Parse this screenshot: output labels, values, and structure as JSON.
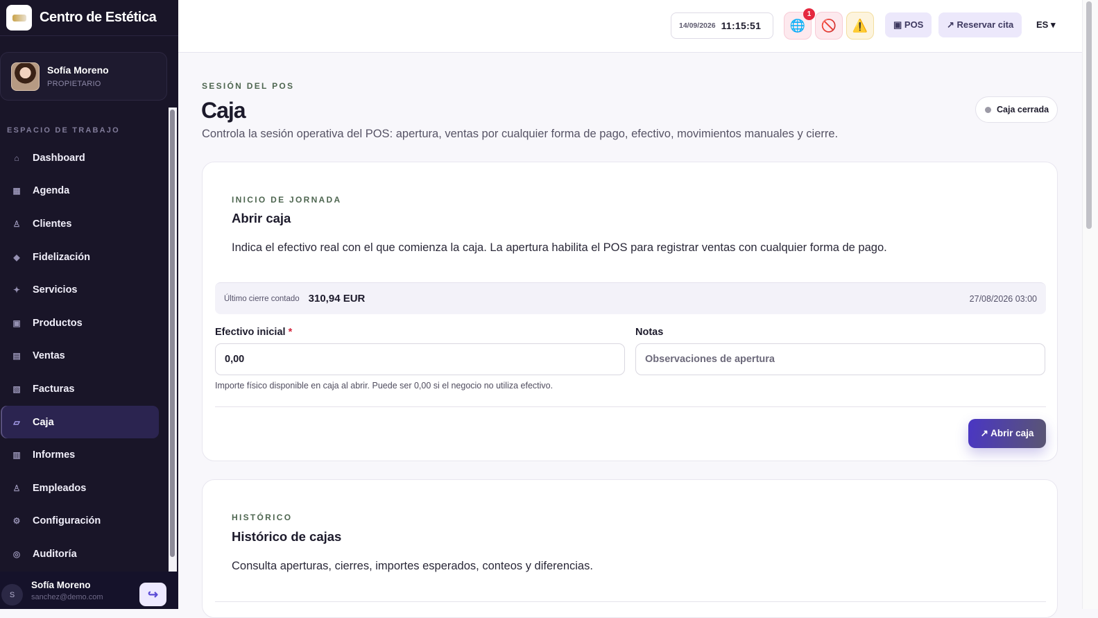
{
  "brand": {
    "name": "Centro de Estética"
  },
  "user": {
    "name": "Sofía Moreno",
    "role": "PROPIETARIO"
  },
  "sidebar": {
    "section_label": "ESPACIO DE TRABAJO",
    "items": [
      {
        "label": "Dashboard",
        "icon": "home-icon",
        "glyph": "⌂"
      },
      {
        "label": "Agenda",
        "icon": "calendar-icon",
        "glyph": "▦"
      },
      {
        "label": "Clientes",
        "icon": "clients-icon",
        "glyph": "♙"
      },
      {
        "label": "Fidelización",
        "icon": "diamond-icon",
        "glyph": "◆"
      },
      {
        "label": "Servicios",
        "icon": "sparkle-icon",
        "glyph": "✦"
      },
      {
        "label": "Productos",
        "icon": "box-icon",
        "glyph": "▣"
      },
      {
        "label": "Ventas",
        "icon": "receipt-icon",
        "glyph": "▤"
      },
      {
        "label": "Facturas",
        "icon": "invoice-icon",
        "glyph": "▧"
      },
      {
        "label": "Caja",
        "icon": "cash-register-icon",
        "glyph": "▱",
        "active": true
      },
      {
        "label": "Informes",
        "icon": "reports-icon",
        "glyph": "▥"
      },
      {
        "label": "Empleados",
        "icon": "employees-icon",
        "glyph": "♙"
      },
      {
        "label": "Configuración",
        "icon": "gear-icon",
        "glyph": "⚙"
      },
      {
        "label": "Auditoría",
        "icon": "audit-icon",
        "glyph": "◎"
      }
    ],
    "footer": {
      "avatar": "S",
      "name": "Sofía Moreno",
      "email": "sanchez@demo.com"
    }
  },
  "topbar": {
    "date": "14/09/2026",
    "time": "11:15:51",
    "globe_badge": "1",
    "pos_label": "▣ POS",
    "book_label": "↗ Reservar cita",
    "lang": "ES ▾"
  },
  "page": {
    "eyebrow": "SESIÓN DEL POS",
    "title": "Caja",
    "subtitle": "Controla la sesión operativa del POS: apertura, ventas por cualquier forma de pago, efectivo, movimientos manuales y cierre.",
    "status": "Caja cerrada"
  },
  "open_card": {
    "eyebrow": "INICIO DE JORNADA",
    "title": "Abrir caja",
    "description": "Indica el efectivo real con el que comienza la caja. La apertura habilita el POS para registrar ventas con cualquier forma de pago.",
    "last_close_label": "Último cierre contado",
    "last_close_value": "310,94 EUR",
    "last_close_date": "27/08/2026 03:00",
    "cash_label": "Efectivo inicial",
    "cash_required": "*",
    "cash_value": "0,00",
    "notes_label": "Notas",
    "notes_placeholder": "Observaciones de apertura",
    "hint": "Importe físico disponible en caja al abrir. Puede ser 0,00 si el negocio no utiliza efectivo.",
    "button": "↗ Abrir caja"
  },
  "history_card": {
    "eyebrow": "HISTÓRICO",
    "title": "Histórico de cajas",
    "description": "Consulta aperturas, cierres, importes esperados, conteos y diferencias."
  }
}
